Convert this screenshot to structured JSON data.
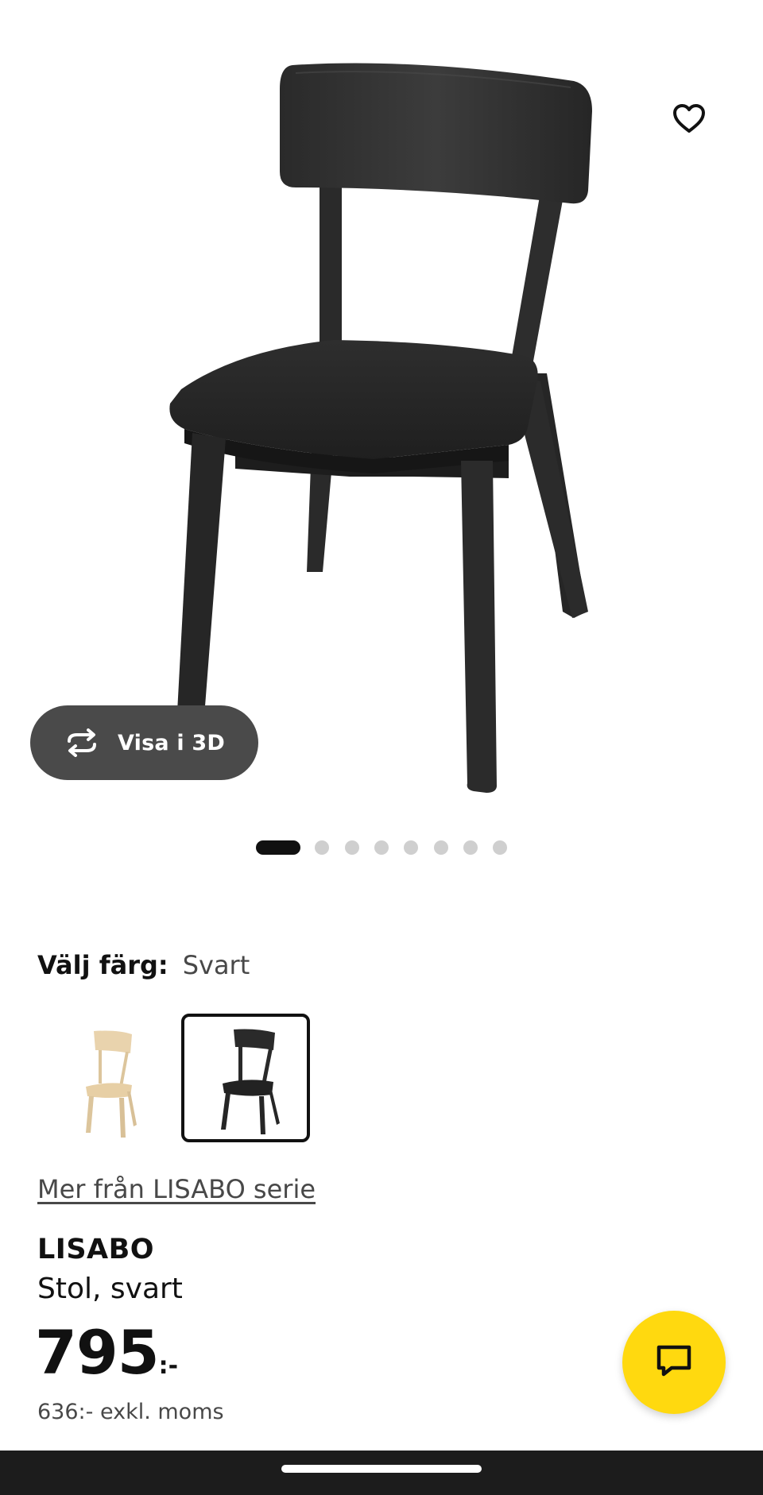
{
  "product_gallery": {
    "image_alt": "LISABO chair, black",
    "view_3d_label": "Visa i 3D",
    "view_3d_icon": "rotate-3d-icon",
    "favorite_icon": "heart-outline-icon",
    "total_images": 8,
    "active_image_index": 0
  },
  "color_selector": {
    "label": "Välj färg:",
    "selected_value": "Svart",
    "options": [
      {
        "name": "ash-veneer",
        "color": "#e9d3ad",
        "selected": false
      },
      {
        "name": "black",
        "color": "#2a2a2a",
        "selected": true
      }
    ]
  },
  "series_link": "Mer från LISABO serie",
  "product": {
    "name": "LISABO",
    "description": "Stol, svart",
    "price": "795",
    "price_suffix": ":-",
    "price_excl_vat": "636:- exkl. moms"
  },
  "chat_button_icon": "chat-icon",
  "colors": {
    "accent_yellow": "#ffd90f",
    "view_3d_bg": "#4a4a4a",
    "nav_bar": "#1c1c1c"
  }
}
